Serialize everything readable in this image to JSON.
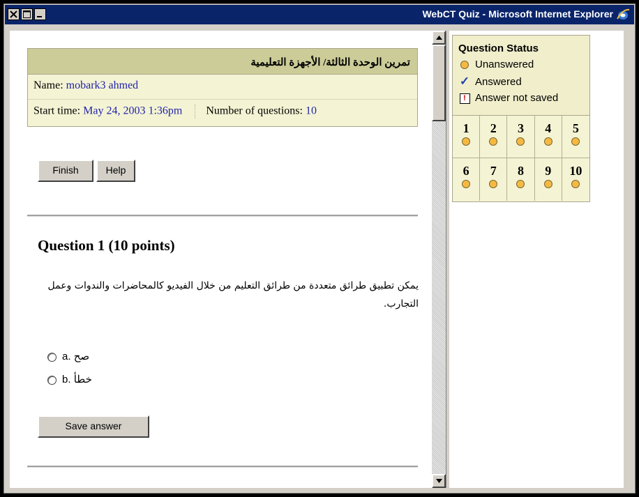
{
  "window": {
    "title": "WebCT Quiz - Microsoft Internet Explorer",
    "controls": [
      "close-icon",
      "maximize-icon",
      "minimize-icon"
    ],
    "icon": "ie-logo-icon"
  },
  "quiz_info": {
    "title": "تمرين الوحدة الثالثة/ الأجهزة التعليمية",
    "name_label": "Name:",
    "name_value": "mobark3 ahmed",
    "start_label": "Start time:",
    "start_value": "May 24, 2003 1:36pm",
    "count_label": "Number of questions:",
    "count_value": "10"
  },
  "toolbar": {
    "finish_label": "Finish",
    "help_label": "Help"
  },
  "question": {
    "heading": "Question 1  (10 points)",
    "text": "يمكن تطبيق طرائق متعددة من طرائق التعليم من خلال الفيديو كالمحاضرات والندوات وعمل التجارب.",
    "options": [
      {
        "letter": "a.",
        "label": "صح"
      },
      {
        "letter": "b.",
        "label": "خطأ"
      }
    ],
    "save_label": "Save answer"
  },
  "status_panel": {
    "title": "Question Status",
    "legend": [
      {
        "icon": "unanswered-dot-icon",
        "label": "Unanswered"
      },
      {
        "icon": "checkmark-icon",
        "label": "Answered"
      },
      {
        "icon": "exclamation-icon",
        "label": "Answer not saved"
      }
    ],
    "questions": [
      "1",
      "2",
      "3",
      "4",
      "5",
      "6",
      "7",
      "8",
      "9",
      "10"
    ],
    "colors": {
      "unanswered": "#f5b942",
      "answered": "#2244aa",
      "not_saved": "#cc0000"
    }
  }
}
